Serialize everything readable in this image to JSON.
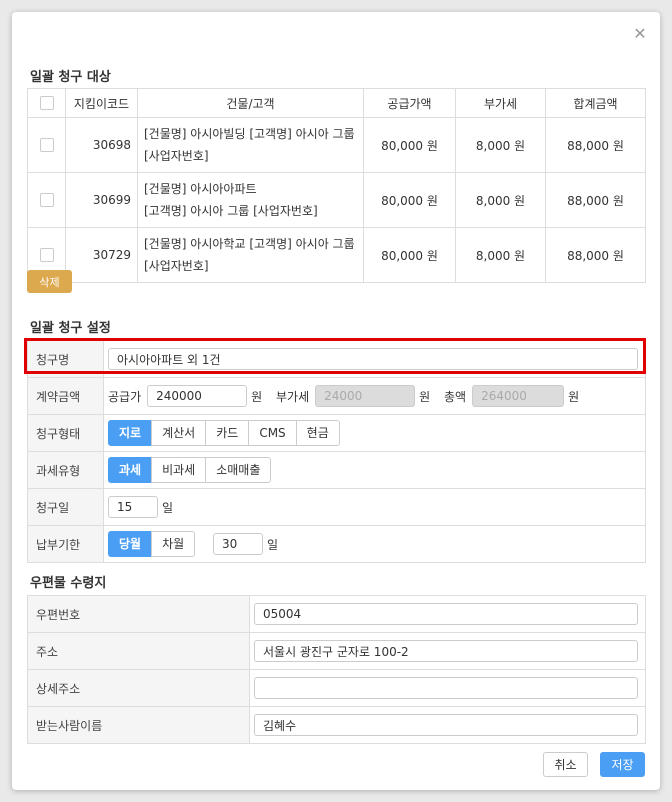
{
  "modal": {
    "close_icon": "close-icon"
  },
  "targets": {
    "title": "일괄 청구 대상",
    "headers": {
      "code": "지킴이코드",
      "building": "건물/고객",
      "supply": "공급가액",
      "vat": "부가세",
      "total": "합계금액"
    },
    "rows": [
      {
        "code": "30698",
        "building_line1": "[건물명] 아시아빌딩 [고객명] 아시아 그룹",
        "building_line2": "[사업자번호]",
        "supply": "80,000 원",
        "vat": "8,000 원",
        "total": "88,000 원"
      },
      {
        "code": "30699",
        "building_line1": "[건물명] 아시아아파트",
        "building_line2": "[고객명] 아시아 그룹 [사업자번호]",
        "supply": "80,000 원",
        "vat": "8,000 원",
        "total": "88,000 원"
      },
      {
        "code": "30729",
        "building_line1": "[건물명] 아시아학교 [고객명] 아시아 그룹",
        "building_line2": "[사업자번호]",
        "supply": "80,000 원",
        "vat": "8,000 원",
        "total": "88,000 원"
      }
    ],
    "delete_label": "삭제"
  },
  "settings": {
    "title": "일괄 청구 설정",
    "name": {
      "label": "청구명",
      "value": "아시아아파트 외 1건"
    },
    "amount": {
      "label": "계약금액",
      "supply_label": "공급가",
      "supply_value": "240000",
      "vat_label": "부가세",
      "vat_value": "24000",
      "total_label": "총액",
      "total_value": "264000",
      "unit": "원"
    },
    "type": {
      "label": "청구형태",
      "options": [
        "지로",
        "계산서",
        "카드",
        "CMS",
        "현금"
      ],
      "selected": "지로"
    },
    "tax": {
      "label": "과세유형",
      "options": [
        "과세",
        "비과세",
        "소매매출"
      ],
      "selected": "과세"
    },
    "day": {
      "label": "청구일",
      "value": "15",
      "unit": "일"
    },
    "due": {
      "label": "납부기한",
      "options": [
        "당월",
        "차월"
      ],
      "selected": "당월",
      "value": "30",
      "unit": "일"
    }
  },
  "mail": {
    "title": "우편물 수령지",
    "rows": [
      {
        "label": "우편번호",
        "value": "05004"
      },
      {
        "label": "주소",
        "value": "서울시 광진구 군자로 100-2"
      },
      {
        "label": "상세주소",
        "value": ""
      },
      {
        "label": "받는사람이름",
        "value": "김혜수"
      }
    ]
  },
  "footer": {
    "cancel_label": "취소",
    "save_label": "저장"
  },
  "colors": {
    "accent": "#4a9ff5",
    "delete": "#dda94e",
    "highlight": "#e00000"
  }
}
